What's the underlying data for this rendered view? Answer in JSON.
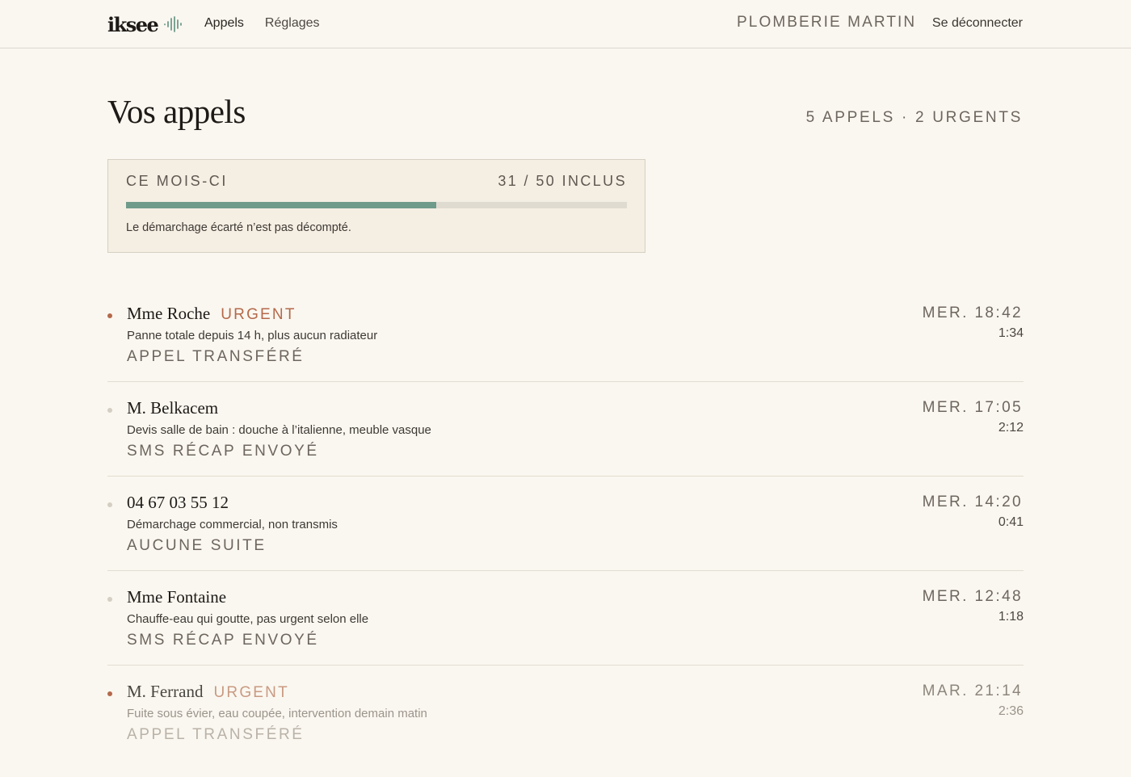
{
  "header": {
    "logo_text": "iksee",
    "nav": [
      {
        "label": "Appels"
      },
      {
        "label": "Réglages"
      }
    ],
    "company": "PLOMBERIE MARTIN",
    "logout_label": "Se déconnecter"
  },
  "page": {
    "title": "Vos appels",
    "summary": "5 APPELS · 2 URGENTS"
  },
  "usage": {
    "label": "CE MOIS-CI",
    "count_text": "31 / 50 INCLUS",
    "used": 31,
    "included": 50,
    "note": "Le démarchage écarté n’est pas décompté.",
    "bar_color": "#6f9b8b"
  },
  "calls": [
    {
      "caller": "Mme Roche",
      "urgent": true,
      "urgent_label": "URGENT",
      "description": "Panne totale depuis 14 h, plus aucun radiateur",
      "outcome": "APPEL TRANSFÉRÉ",
      "when": "MER. 18:42",
      "duration": "1:34"
    },
    {
      "caller": "M. Belkacem",
      "urgent": false,
      "urgent_label": "",
      "description": "Devis salle de bain : douche à l’italienne, meuble vasque",
      "outcome": "SMS RÉCAP ENVOYÉ",
      "when": "MER. 17:05",
      "duration": "2:12"
    },
    {
      "caller": "04 67 03 55 12",
      "urgent": false,
      "urgent_label": "",
      "description": "Démarchage commercial, non transmis",
      "outcome": "AUCUNE SUITE",
      "when": "MER. 14:20",
      "duration": "0:41"
    },
    {
      "caller": "Mme Fontaine",
      "urgent": false,
      "urgent_label": "",
      "description": "Chauffe-eau qui goutte, pas urgent selon elle",
      "outcome": "SMS RÉCAP ENVOYÉ",
      "when": "MER. 12:48",
      "duration": "1:18"
    },
    {
      "caller": "M. Ferrand",
      "urgent": true,
      "urgent_label": "URGENT",
      "description": "Fuite sous évier, eau coupée, intervention demain matin",
      "outcome": "APPEL TRANSFÉRÉ",
      "when": "MAR. 21:14",
      "duration": "2:36"
    }
  ],
  "colors": {
    "background": "#faf7f0",
    "urgent": "#b4694a",
    "accent": "#6f9b8b"
  }
}
